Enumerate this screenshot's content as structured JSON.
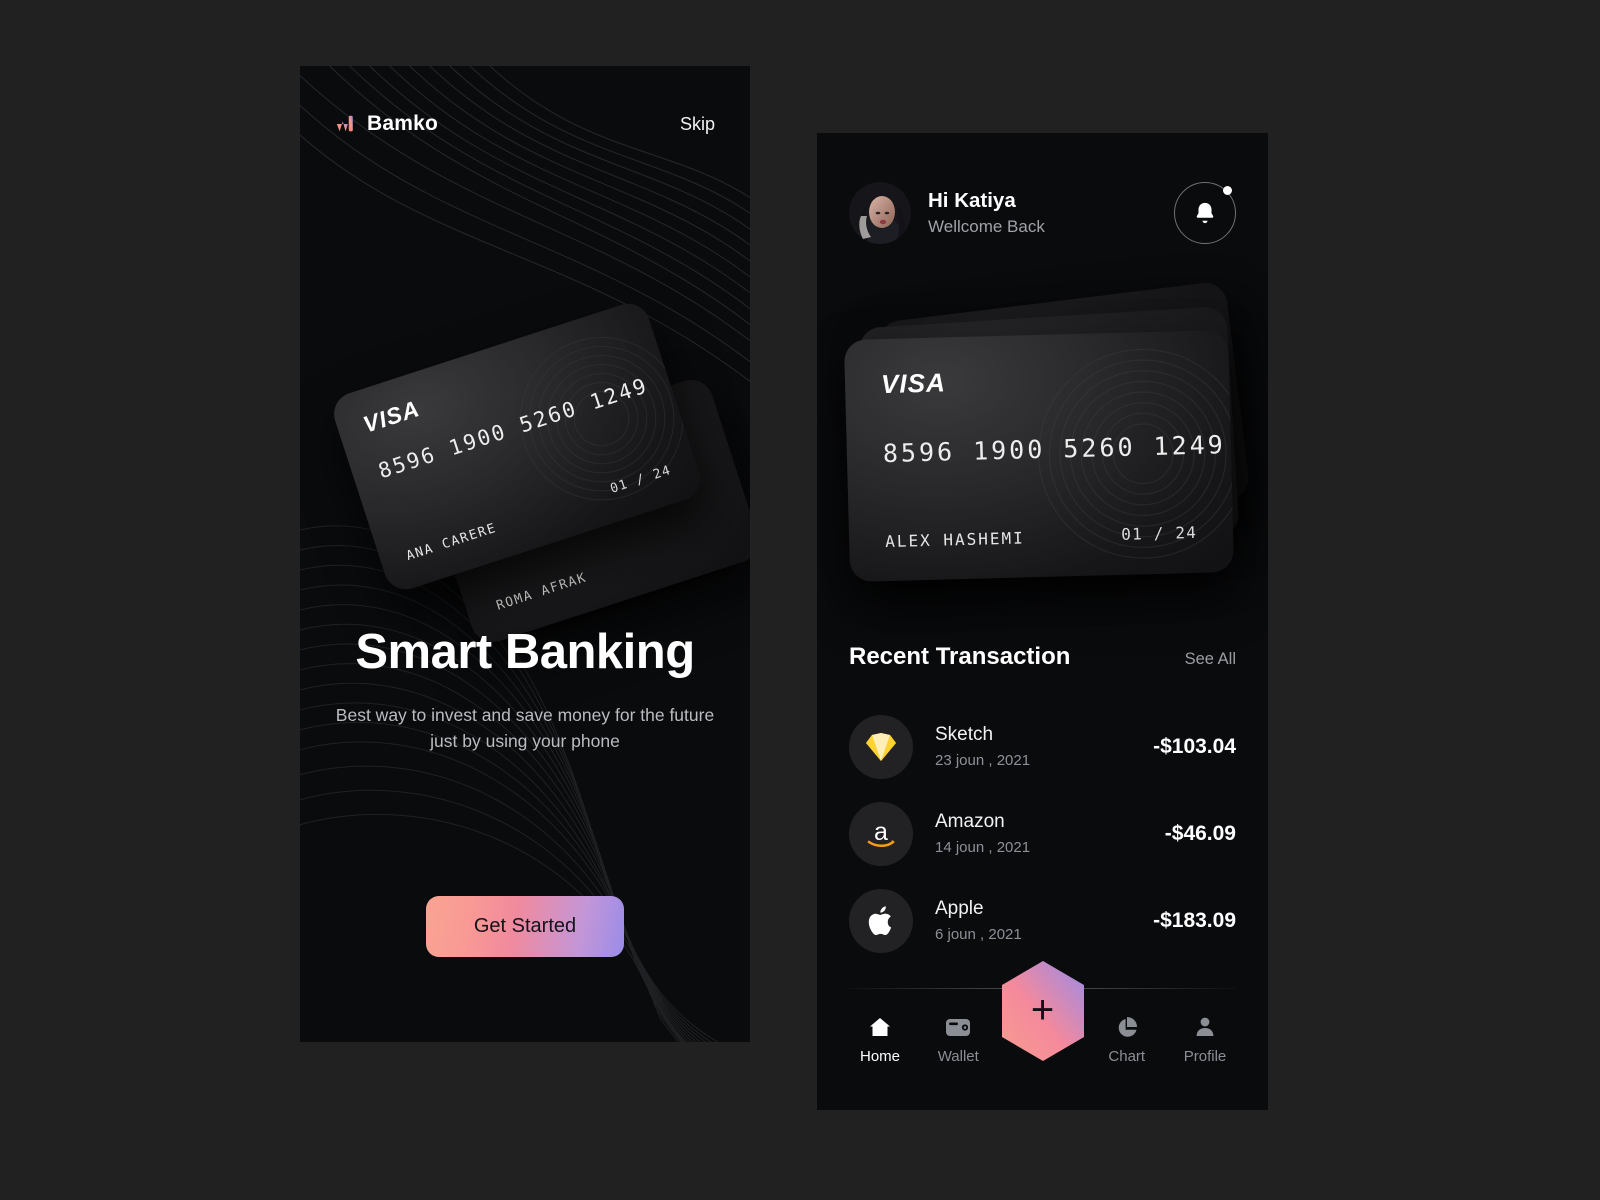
{
  "theme": {
    "page_bg": "#212121",
    "panel_bg": "#0a0b0d",
    "accent_gradient_start": "#f9a492",
    "accent_gradient_mid": "#f08a9e",
    "accent_gradient_end": "#9a8ce8",
    "text_primary": "#ffffff",
    "text_muted": "#9a9da2",
    "sketch_yellow": "#f7b500",
    "amazon_orange": "#f59b14"
  },
  "onboarding": {
    "brand": {
      "name": "Bamko",
      "mark_icon": "bamko-logo-icon"
    },
    "skip_label": "Skip",
    "card_front": {
      "network": "VISA",
      "number": "8596 1900 5260 1249",
      "holder": "ANA CARERE",
      "expiry": "01 / 24"
    },
    "card_back": {
      "holder": "ROMA AFRAK"
    },
    "title": "Smart Banking",
    "subtitle": "Best way to invest and save money for the future just by using your phone",
    "cta_label": "Get Started"
  },
  "home": {
    "greeting_name": "Hi Katiya",
    "greeting_sub": "Wellcome Back",
    "avatar_icon": "user-avatar",
    "notification_icon": "bell-icon",
    "has_notification": true,
    "card_front": {
      "network": "VISA",
      "number": "8596 1900 5260 1249",
      "holder": "ALEX HASHEMI",
      "expiry": "01 / 24"
    },
    "transactions_title": "Recent Transaction",
    "see_all_label": "See All",
    "transactions": [
      {
        "name": "Sketch",
        "date": "23 joun , 2021",
        "amount": "-$103.04",
        "icon": "sketch-icon"
      },
      {
        "name": "Amazon",
        "date": "14 joun , 2021",
        "amount": "-$46.09",
        "icon": "amazon-icon"
      },
      {
        "name": "Apple",
        "date": "6 joun , 2021",
        "amount": "-$183.09",
        "icon": "apple-icon"
      }
    ],
    "nav": {
      "add_label": "+",
      "items": [
        {
          "label": "Home",
          "icon": "home-icon",
          "active": true
        },
        {
          "label": "Wallet",
          "icon": "wallet-icon",
          "active": false
        },
        {
          "label": "Chart",
          "icon": "chart-pie-icon",
          "active": false
        },
        {
          "label": "Profile",
          "icon": "profile-icon",
          "active": false
        }
      ]
    }
  }
}
